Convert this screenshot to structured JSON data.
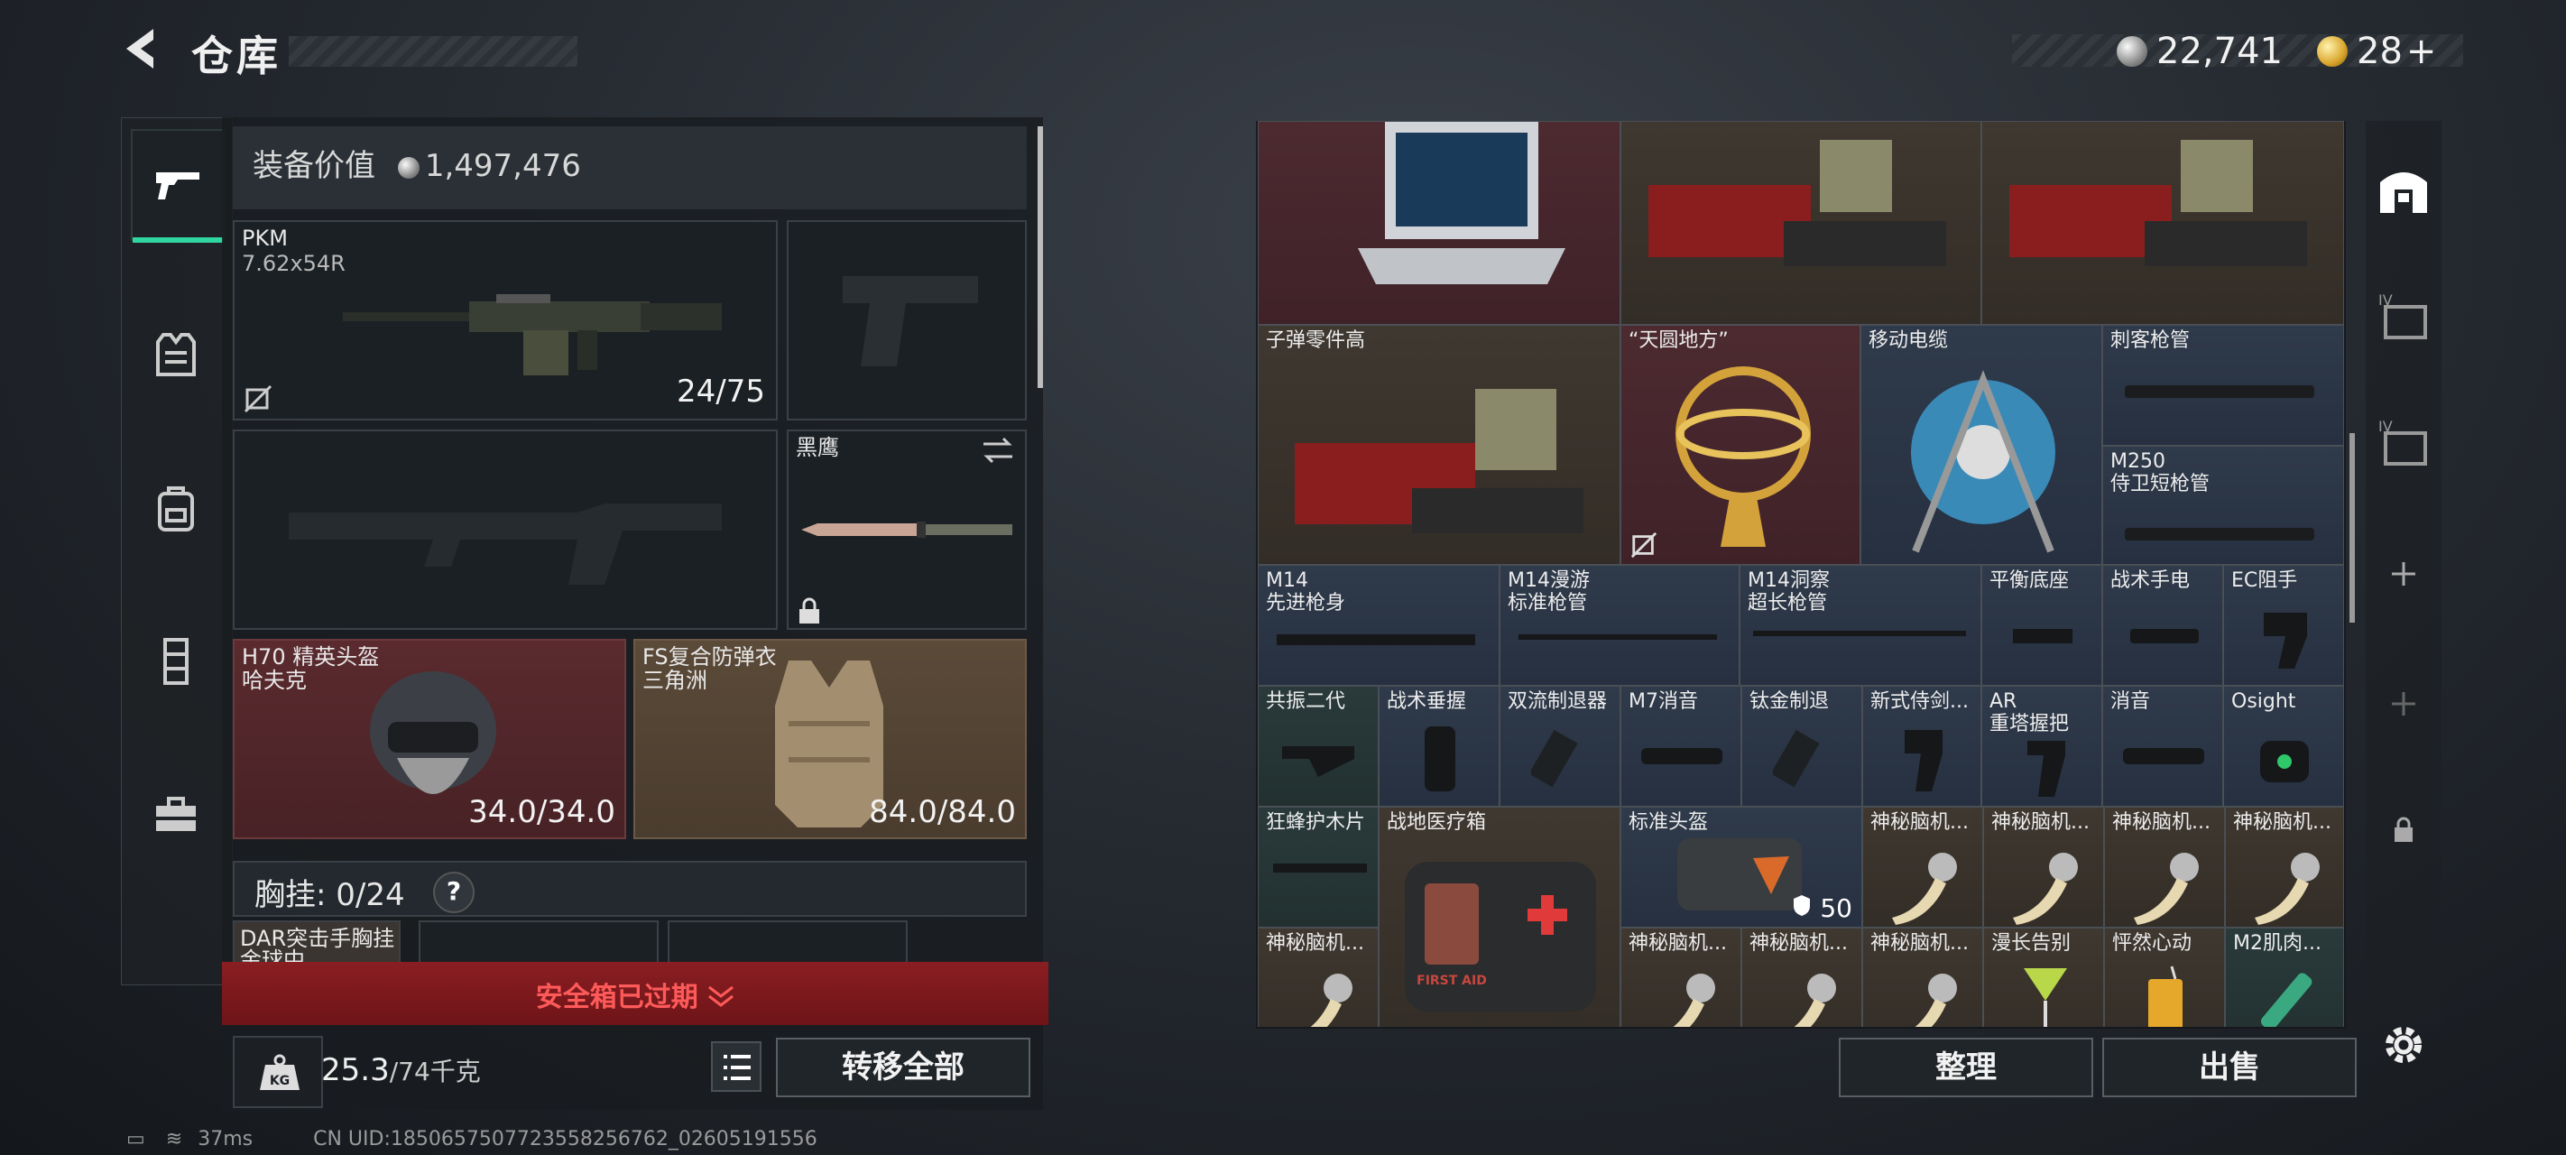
{
  "header": {
    "title": "仓库",
    "back_icon": "chevron-left-icon"
  },
  "currency": {
    "silver_value": "22,741",
    "gold_value": "28",
    "plus": "+"
  },
  "left_nav": {
    "items": [
      "gun-icon",
      "vest-icon",
      "backpack-icon",
      "rig-icon",
      "briefcase-icon"
    ],
    "active": 0
  },
  "equipment": {
    "value_label": "装备价值",
    "value": "1,497,476",
    "primary": {
      "name": "PKM",
      "caliber": "7.62x54R",
      "ammo": "24/75"
    },
    "knife": {
      "name": "黑鹰"
    },
    "helmet": {
      "name": "H70 精英头盔",
      "sub": "哈夫克",
      "durability": "34.0/34.0"
    },
    "armor": {
      "name": "FS复合防弹衣",
      "sub": "三角洲",
      "durability": "84.0/84.0"
    },
    "chest_rig": {
      "label": "胸挂: ",
      "count": "0/24",
      "help": "?"
    },
    "chest_item": {
      "name": "DAR突击手胸挂",
      "sub": "金球中"
    }
  },
  "safe_box": {
    "text": "安全箱已过期"
  },
  "weight": {
    "value": "25.3",
    "max": "/74千克"
  },
  "buttons": {
    "transfer_all": "转移全部",
    "organize": "整理",
    "sell": "出售"
  },
  "storage": {
    "row2": [
      {
        "name": "子弹零件高"
      },
      {
        "name": "“天圆地方”"
      },
      {
        "name": "移动电缆"
      },
      {
        "name": "刺客枪管"
      },
      {
        "name": "M250\n侍卫短枪管"
      }
    ],
    "row3": [
      {
        "name": "M14\n先进枪身"
      },
      {
        "name": "M14漫游\n标准枪管"
      },
      {
        "name": "M14洞察\n超长枪管"
      },
      {
        "name": "平衡底座"
      },
      {
        "name": "战术手电"
      },
      {
        "name": "EC阻手"
      }
    ],
    "row4": [
      {
        "name": "共振二代"
      },
      {
        "name": "战术垂握"
      },
      {
        "name": "双流制退器"
      },
      {
        "name": "M7消音"
      },
      {
        "name": "钛金制退"
      },
      {
        "name": "新式侍剑..."
      },
      {
        "name": "AR\n重塔握把"
      },
      {
        "name": "消音"
      },
      {
        "name": "Osight"
      }
    ],
    "row5": [
      {
        "name": "狂蜂护木片"
      },
      {
        "name": "战地医疗箱"
      },
      {
        "name": "标准头盔",
        "count": "50"
      },
      {
        "name": "神秘脑机..."
      },
      {
        "name": "神秘脑机..."
      },
      {
        "name": "神秘脑机..."
      },
      {
        "name": "神秘脑机..."
      }
    ],
    "row6": [
      {
        "name": "神秘脑机..."
      },
      {
        "name": "神秘脑机..."
      },
      {
        "name": "神秘脑机..."
      },
      {
        "name": "神秘脑机..."
      },
      {
        "name": "漫长告别"
      },
      {
        "name": "怦然心动"
      },
      {
        "name": "M2肌肉..."
      }
    ],
    "medkit_label": "FIRST AID"
  },
  "right_nav": {
    "tier_label": "IV"
  },
  "status_bar": {
    "ping": "37ms",
    "uid": "CN UID:1850657507723558256762_02605191556"
  }
}
